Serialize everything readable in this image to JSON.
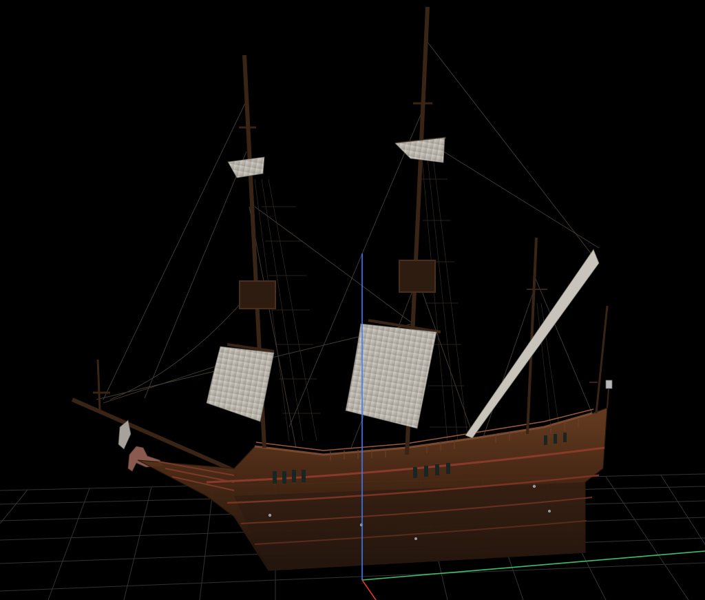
{
  "viewport": {
    "background": "#000000",
    "grid_color": "#3a3a3a",
    "axis_x_color": "#3fbf6a",
    "axis_y_color": "#3a7bff",
    "axis_z_color": "#e03a2a"
  },
  "model": {
    "hull_color": "#4a2c18",
    "hull_dark": "#2a170c",
    "trim_color": "#8a3a2a",
    "mast_color": "#3a2416",
    "sail_color": "#cfcac2",
    "rigging_color": "#5a5048"
  },
  "icons": [
    "grid-floor",
    "axis-gizmo",
    "ship-model"
  ]
}
